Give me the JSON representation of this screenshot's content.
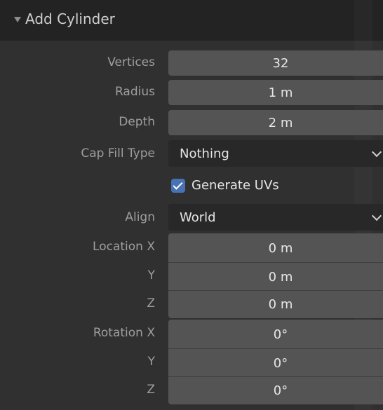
{
  "panel": {
    "title": "Add Cylinder",
    "vertices": {
      "label": "Vertices",
      "value": "32"
    },
    "radius": {
      "label": "Radius",
      "value": "1 m"
    },
    "depth": {
      "label": "Depth",
      "value": "2 m"
    },
    "cap_fill": {
      "label": "Cap Fill Type",
      "value": "Nothing"
    },
    "generate_uvs": {
      "label": "Generate UVs",
      "checked": true
    },
    "align": {
      "label": "Align",
      "value": "World"
    },
    "location": {
      "label_x": "Location X",
      "label_y": "Y",
      "label_z": "Z",
      "x": "0 m",
      "y": "0 m",
      "z": "0 m"
    },
    "rotation": {
      "label_x": "Rotation X",
      "label_y": "Y",
      "label_z": "Z",
      "x": "0°",
      "y": "0°",
      "z": "0°"
    }
  },
  "colors": {
    "panel_bg": "#303030",
    "header_bg": "#232323",
    "field_bg": "#545454",
    "dropdown_bg": "#282828",
    "checkbox_accent": "#4772b3"
  },
  "icons": {
    "collapse": "triangle-down-icon",
    "dropdown": "chevron-down-icon",
    "checkbox": "checkmark-icon"
  }
}
